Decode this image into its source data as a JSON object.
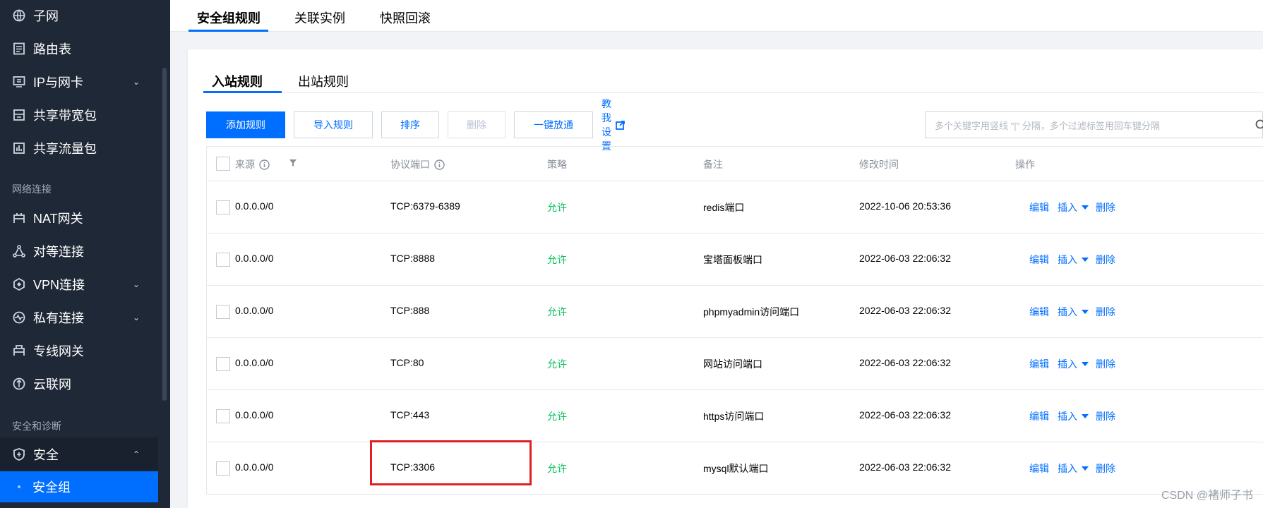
{
  "sidebar": {
    "items": [
      {
        "label": "子网",
        "icon": "subnet-icon"
      },
      {
        "label": "路由表",
        "icon": "route-table-icon"
      },
      {
        "label": "IP与网卡",
        "icon": "ip-nic-icon",
        "expandable": true
      },
      {
        "label": "共享带宽包",
        "icon": "bandwidth-package-icon"
      },
      {
        "label": "共享流量包",
        "icon": "traffic-package-icon"
      }
    ],
    "group_network": "网络连接",
    "network_items": [
      {
        "label": "NAT网关",
        "icon": "nat-gateway-icon"
      },
      {
        "label": "对等连接",
        "icon": "peering-icon"
      },
      {
        "label": "VPN连接",
        "icon": "vpn-icon",
        "expandable": true
      },
      {
        "label": "私有连接",
        "icon": "private-link-icon",
        "expandable": true
      },
      {
        "label": "专线网关",
        "icon": "dc-gateway-icon"
      },
      {
        "label": "云联网",
        "icon": "ccn-icon"
      }
    ],
    "group_security": "安全和诊断",
    "security_item": {
      "label": "安全",
      "icon": "shield-icon",
      "expanded": true
    },
    "security_sub_active": "安全组"
  },
  "top_tabs": [
    {
      "label": "安全组规则",
      "active": true
    },
    {
      "label": "关联实例",
      "active": false
    },
    {
      "label": "快照回滚",
      "active": false
    }
  ],
  "sub_tabs": [
    {
      "label": "入站规则",
      "active": true
    },
    {
      "label": "出站规则",
      "active": false
    }
  ],
  "toolbar": {
    "add_rule": "添加规则",
    "import_rule": "导入规则",
    "sort": "排序",
    "delete": "删除",
    "one_click_open": "一键放通",
    "teach_me": "教我设置"
  },
  "search": {
    "placeholder": "多个关键字用竖线 \"|\" 分隔，多个过滤标签用回车键分隔"
  },
  "table": {
    "headers": {
      "source": "来源",
      "protocol_port": "协议端口",
      "policy": "策略",
      "remark": "备注",
      "modified": "修改时间",
      "actions": "操作"
    },
    "rows": [
      {
        "source": "0.0.0.0/0",
        "port": "TCP:6379-6389",
        "policy": "允许",
        "remark": "redis端口",
        "time": "2022-10-06 20:53:36"
      },
      {
        "source": "0.0.0.0/0",
        "port": "TCP:8888",
        "policy": "允许",
        "remark": "宝塔面板端口",
        "time": "2022-06-03 22:06:32"
      },
      {
        "source": "0.0.0.0/0",
        "port": "TCP:888",
        "policy": "允许",
        "remark": "phpmyadmin访问端口",
        "time": "2022-06-03 22:06:32"
      },
      {
        "source": "0.0.0.0/0",
        "port": "TCP:80",
        "policy": "允许",
        "remark": "网站访问端口",
        "time": "2022-06-03 22:06:32"
      },
      {
        "source": "0.0.0.0/0",
        "port": "TCP:443",
        "policy": "允许",
        "remark": "https访问端口",
        "time": "2022-06-03 22:06:32"
      },
      {
        "source": "0.0.0.0/0",
        "port": "TCP:3306",
        "policy": "允许",
        "remark": "mysql默认端口",
        "time": "2022-06-03 22:06:32"
      }
    ],
    "actions": {
      "edit": "编辑",
      "insert": "插入",
      "delete": "删除"
    }
  },
  "watermark": "CSDN @褚师子书",
  "colors": {
    "accent": "#006eff",
    "allow": "#0abf5b",
    "sidebar_bg": "#1f2836",
    "highlight_box": "#e02020"
  }
}
